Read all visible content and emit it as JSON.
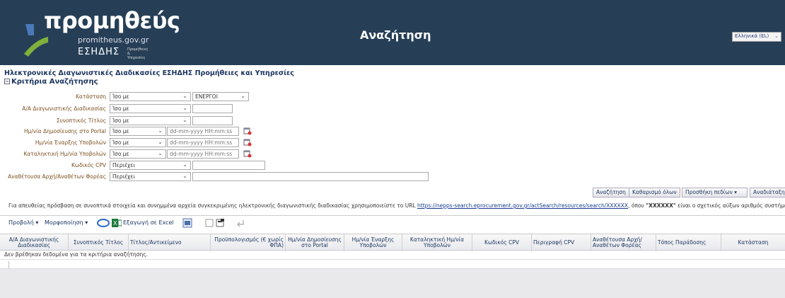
{
  "header": {
    "logo_text": "προμηθεύς",
    "logo_domain": "promitheus.gov.gr",
    "logo_esidis": "ΕΣΗΔΗΣ",
    "logo_esidis_small_1": "Προμήθειες",
    "logo_esidis_small_2": "& Υπηρεσίες",
    "page_title": "Αναζήτηση",
    "language": "Ελληνικά (EL)"
  },
  "subtitle": "Ηλεκτρονικές Διαγωνιστικές Διαδικασίες ΕΣΗΔΗΣ Προμήθειες και Υπηρεσίες",
  "criteria_title": "Κριτήρια Αναζήτησης",
  "criteria": {
    "status": {
      "label": "Κατάσταση",
      "op": "Ίσο με",
      "value": "ΕΝΕΡΓΟΙ"
    },
    "proc_id": {
      "label": "Α/Α Διαγωνιστικής Διαδικασίας",
      "op": "Ίσο με",
      "value": ""
    },
    "short_title": {
      "label": "Συνοπτικός Τίτλος",
      "op": "Ίσο με",
      "value": ""
    },
    "pub_date": {
      "label": "Ημ/νία Δημοσίευσης στο Portal",
      "op": "Ίσο με",
      "placeholder": "dd-mm-yyyy HH:mm:ss"
    },
    "start_date": {
      "label": "Ημ/νία Έναρξης Υποβολών",
      "op": "Ίσο με",
      "placeholder": "dd-mm-yyyy HH:mm:ss"
    },
    "end_date": {
      "label": "Καταληκτική Ημ/νία Υποβολών",
      "op": "Ίσο με",
      "placeholder": "dd-mm-yyyy HH:mm:ss"
    },
    "cpv": {
      "label": "Κωδικός CPV",
      "op": "Περιέχει",
      "value": ""
    },
    "authority": {
      "label": "Αναθέτουσα Αρχή/Αναθέτων Φορέας",
      "op": "Περιέχει",
      "value": ""
    }
  },
  "buttons": {
    "search": "Αναζήτηση",
    "clear": "Καθαρισμό όλων",
    "add_fields": "Προσθήκη πεδίων",
    "reorder": "Αναδιάταξη"
  },
  "url_note": {
    "before": "Για απευθείας πρόσβαση σε συνοπτικά στοιχεία και συνημμένα αρχεία συγκεκριμένης ηλεκτρονικής διαγωνιστικής διαδικασίας χρησιμοποιείστε το URL",
    "url": "https://nepps-search.eprocurement.gov.gr/actSearch/resources/search/XXXXXX",
    "middle": ", όπου",
    "code": "\"XXXXXX\"",
    "after": "είναι ο σχετικός αύξων αριθμός συστήματος."
  },
  "toolbar": {
    "view": "Προβολή",
    "format": "Μορφοποίηση",
    "export": "Εξαγωγή σε Excel"
  },
  "columns": [
    "Α/Α Διαγωνιστικής Διαδικασίας",
    "Συνοπτικός Τίτλος",
    "Τίτλος/Αντικείμενο",
    "Προϋπολογισμός (€ χωρίς ΦΠΑ)",
    "Ημ/νία Δημοσίευσης στο Portal",
    "Ημ/νία Έναρξης Υποβολών",
    "Καταληκτική Ημ/νία Υποβολών",
    "Κωδικός CPV",
    "Περιγραφή CPV",
    "Αναθέτουσα Αρχή/ Αναθέτων Φορέας",
    "Τόπος Παράδοσης",
    "Κατάσταση"
  ],
  "empty_message": "Δεν βρέθηκαν δεδομένα για τα κριτήρια αναζήτησης.",
  "colors": {
    "header_bg": "#263f57",
    "label_brown": "#7a5220",
    "title_navy": "#1c3560"
  }
}
